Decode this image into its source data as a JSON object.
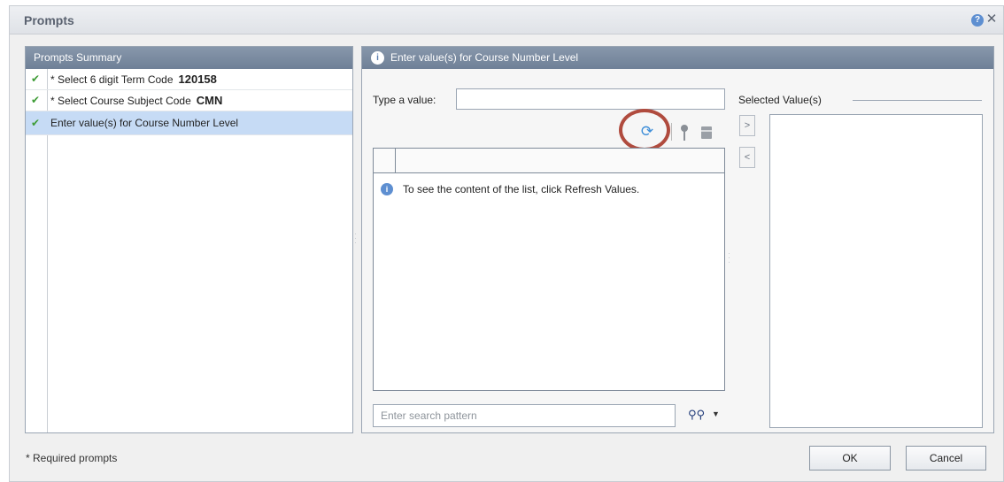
{
  "dialog": {
    "title": "Prompts",
    "help_icon": "help-icon",
    "close_icon": "close-icon"
  },
  "summary": {
    "header": "Prompts Summary",
    "items": [
      {
        "label": "* Select 6 digit Term Code",
        "value": "120158",
        "status": "checked"
      },
      {
        "label": "* Select Course Subject Code",
        "value": "CMN",
        "status": "checked"
      },
      {
        "label": "Enter value(s) for Course Number Level",
        "value": "",
        "status": "checked",
        "selected": true
      }
    ]
  },
  "main": {
    "header": "Enter value(s) for Course Number Level",
    "type_label": "Type a value:",
    "type_value": "",
    "list_message": "To see the content of the list, click Refresh Values.",
    "search_placeholder": "Enter search pattern",
    "move_right": ">",
    "move_left": "<",
    "selected_title": "Selected Value(s)"
  },
  "footer": {
    "required_note": "* Required prompts",
    "ok_label": "OK",
    "cancel_label": "Cancel"
  },
  "colors": {
    "header_bg": "#7b8ca2",
    "selected_row": "#c6dbf5",
    "check": "#3e9c36",
    "highlight_ring": "#b04b3e"
  }
}
